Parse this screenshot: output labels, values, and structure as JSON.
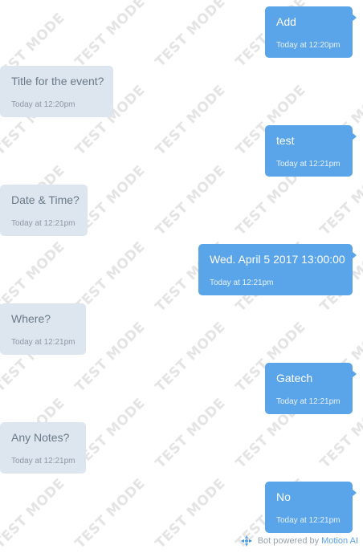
{
  "watermark": {
    "text": "TEST MODE"
  },
  "messages": [
    {
      "sender": "user",
      "text": "Add",
      "timestamp": "Today at 12:20pm"
    },
    {
      "sender": "bot",
      "text": "Title for the event?",
      "timestamp": "Today at 12:20pm"
    },
    {
      "sender": "user",
      "text": "test",
      "timestamp": "Today at 12:21pm"
    },
    {
      "sender": "bot",
      "text": "Date & Time?",
      "timestamp": "Today at 12:21pm"
    },
    {
      "sender": "user",
      "text": "Wed. April 5 2017 13:00:00",
      "timestamp": "Today at 12:21pm"
    },
    {
      "sender": "bot",
      "text": "Where?",
      "timestamp": "Today at 12:21pm"
    },
    {
      "sender": "user",
      "text": "Gatech",
      "timestamp": "Today at 12:21pm"
    },
    {
      "sender": "bot",
      "text": "Any Notes?",
      "timestamp": "Today at 12:21pm"
    },
    {
      "sender": "user",
      "text": "No",
      "timestamp": "Today at 12:21pm"
    }
  ],
  "footer": {
    "prefix": "Bot powered by",
    "link_text": "Motion AI",
    "logo_icon": "motion-ai-logo-icon"
  },
  "colors": {
    "user_bubble": "#5aa4ea",
    "bot_bubble": "#dde5ee",
    "bot_text": "#6a7a88",
    "watermark": "#e4e4e4"
  }
}
